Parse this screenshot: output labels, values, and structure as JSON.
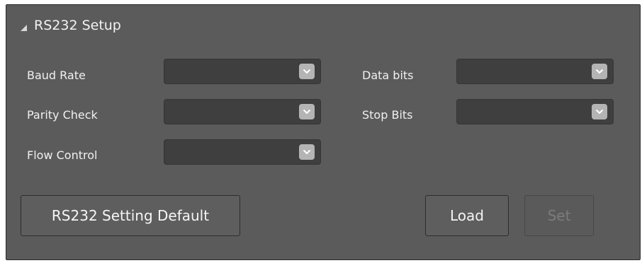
{
  "section": {
    "title": "RS232 Setup",
    "collapse_icon": "collapse-triangle-icon"
  },
  "fields": {
    "baud_rate": {
      "label": "Baud Rate",
      "value": ""
    },
    "data_bits": {
      "label": "Data bits",
      "value": ""
    },
    "parity_check": {
      "label": "Parity Check",
      "value": ""
    },
    "stop_bits": {
      "label": "Stop Bits",
      "value": ""
    },
    "flow_control": {
      "label": "Flow Control",
      "value": ""
    }
  },
  "buttons": {
    "default_label": "RS232 Setting Default",
    "load_label": "Load",
    "set_label": "Set",
    "set_enabled": false
  },
  "colors": {
    "panel_background": "#5b5b5b",
    "dropdown_background": "#3f3f3f",
    "chevron_box": "#b4b4b4",
    "text": "#f0f0f0",
    "disabled_text": "#7c7c7c"
  }
}
